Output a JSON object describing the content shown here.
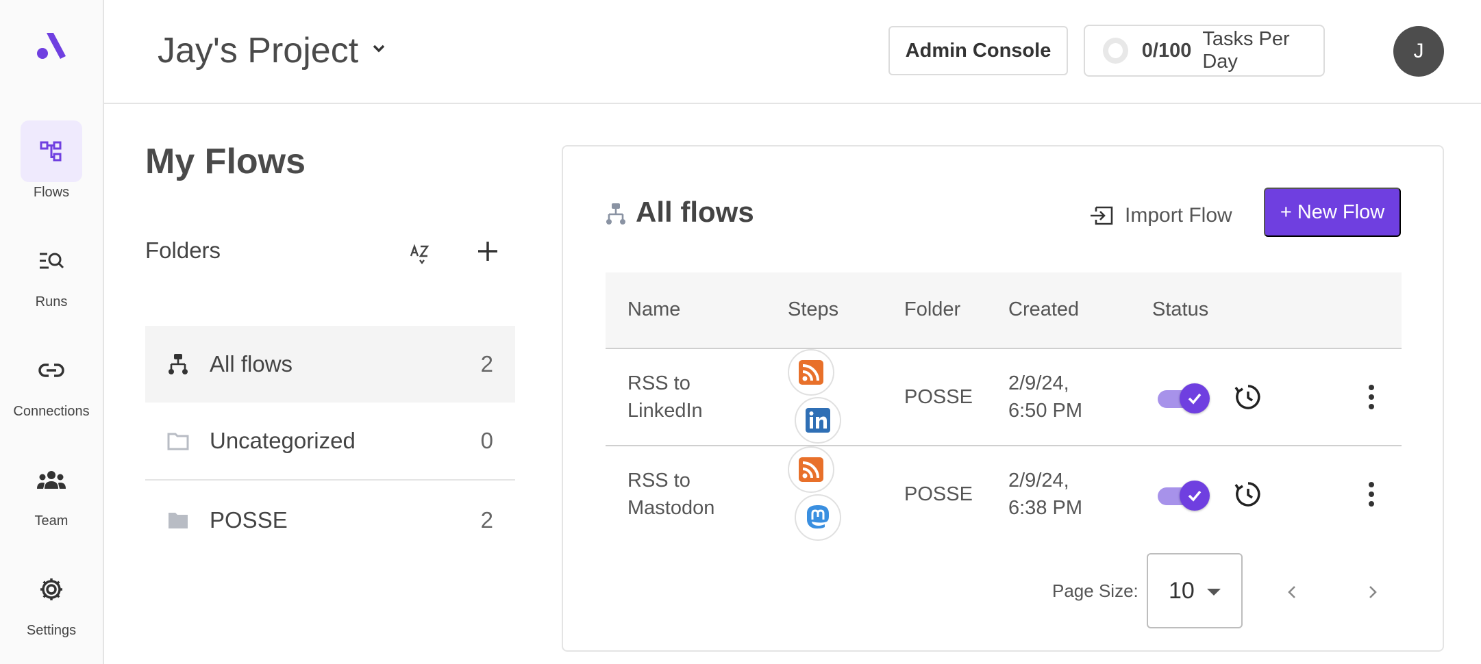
{
  "sidebar": {
    "items": [
      {
        "label": "Flows",
        "icon": "flows-icon",
        "active": true
      },
      {
        "label": "Runs",
        "icon": "runs-icon"
      },
      {
        "label": "Connections",
        "icon": "link-icon"
      },
      {
        "label": "Team",
        "icon": "team-icon"
      },
      {
        "label": "Settings",
        "icon": "gear-icon"
      }
    ]
  },
  "header": {
    "project": "Jay's Project",
    "admin_console": "Admin Console",
    "tasks_count": "0/100",
    "tasks_label": "Tasks Per Day",
    "avatar_initial": "J"
  },
  "left": {
    "title": "My Flows",
    "folders_label": "Folders",
    "folders": [
      {
        "name": "All flows",
        "count": "2"
      },
      {
        "name": "Uncategorized",
        "count": "0"
      },
      {
        "name": "POSSE",
        "count": "2"
      }
    ]
  },
  "main": {
    "title": "All flows",
    "import_label": "Import Flow",
    "new_flow_label": "+ New Flow",
    "columns": [
      "Name",
      "Steps",
      "Folder",
      "Created",
      "Status"
    ],
    "rows": [
      {
        "name_line1": "RSS to",
        "name_line2": "LinkedIn",
        "folder": "POSSE",
        "created_line1": "2/9/24,",
        "created_line2": "6:50 PM",
        "steps": [
          "rss-icon",
          "linkedin-icon"
        ],
        "enabled": true
      },
      {
        "name_line1": "RSS to",
        "name_line2": "Mastodon",
        "folder": "POSSE",
        "created_line1": "2/9/24,",
        "created_line2": "6:38 PM",
        "steps": [
          "rss-icon",
          "mastodon-icon"
        ],
        "enabled": true
      }
    ],
    "page_size_label": "Page Size:",
    "page_size_value": "10"
  },
  "colors": {
    "accent": "#6f3fe0",
    "accent_light": "#efeafd",
    "rss": "#e8702a",
    "linkedin": "#2f6fb5",
    "mastodon": "#3a8fe0"
  }
}
